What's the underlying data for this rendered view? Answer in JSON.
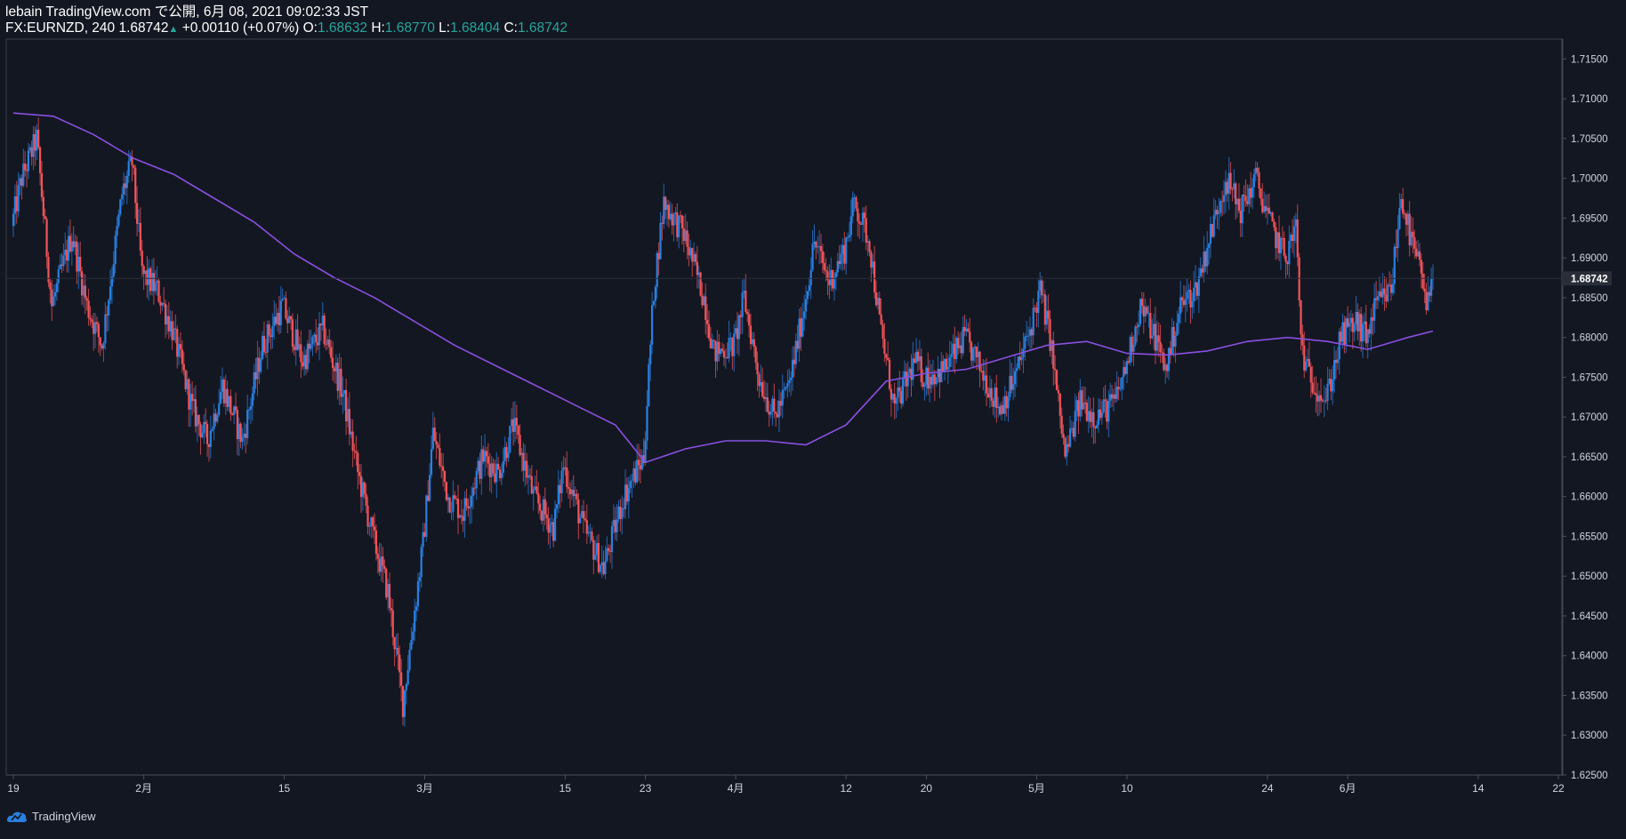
{
  "header": {
    "publish_line": "lebain TradingView.com で公開, 6月 08, 2021 09:02:33 JST",
    "symbol": "FX:EURNZD, 240",
    "last": "1.68742",
    "change": "+0.00110 (+0.07%)",
    "o_label": "O:",
    "o_value": "1.68632",
    "h_label": "H:",
    "h_value": "1.68770",
    "l_label": "L:",
    "l_value": "1.68404",
    "c_label": "C:",
    "c_value": "1.68742"
  },
  "footer": {
    "brand": "TradingView"
  },
  "colors": {
    "background": "#131722",
    "up": "#2a80e0",
    "down": "#f0545a",
    "ma": "#8a50e0",
    "axis_text": "#d1d4dc",
    "accent_green": "#26a69a"
  },
  "chart_data": {
    "type": "candlestick",
    "symbol": "FX:EURNZD",
    "interval": "240",
    "ylim": [
      1.625,
      1.7175
    ],
    "y_ticks": [
      "1.71500",
      "1.71000",
      "1.70500",
      "1.70000",
      "1.69500",
      "1.69000",
      "1.68500",
      "1.68000",
      "1.67500",
      "1.67000",
      "1.66500",
      "1.66000",
      "1.65500",
      "1.65000",
      "1.64500",
      "1.64000",
      "1.63500",
      "1.63000",
      "1.62500"
    ],
    "last_price_label": "1.68742",
    "last_price": 1.68742,
    "x_ticks": [
      {
        "label": "19",
        "day": 0
      },
      {
        "label": "2月",
        "day": 13
      },
      {
        "label": "15",
        "day": 27
      },
      {
        "label": "3月",
        "day": 41
      },
      {
        "label": "15",
        "day": 55
      },
      {
        "label": "23",
        "day": 63
      },
      {
        "label": "4月",
        "day": 72
      },
      {
        "label": "12",
        "day": 83
      },
      {
        "label": "20",
        "day": 91
      },
      {
        "label": "5月",
        "day": 102
      },
      {
        "label": "10",
        "day": 111
      },
      {
        "label": "24",
        "day": 125
      },
      {
        "label": "6月",
        "day": 133
      },
      {
        "label": "14",
        "day": 146
      },
      {
        "label": "22",
        "day": 154
      }
    ],
    "price_path": [
      {
        "day": 0,
        "price": 1.694
      },
      {
        "day": 1,
        "price": 1.7
      },
      {
        "day": 2.5,
        "price": 1.705
      },
      {
        "day": 4,
        "price": 1.684
      },
      {
        "day": 6,
        "price": 1.693
      },
      {
        "day": 7.5,
        "price": 1.684
      },
      {
        "day": 9,
        "price": 1.679
      },
      {
        "day": 11,
        "price": 1.698
      },
      {
        "day": 12,
        "price": 1.702
      },
      {
        "day": 13,
        "price": 1.688
      },
      {
        "day": 14.5,
        "price": 1.686
      },
      {
        "day": 16,
        "price": 1.681
      },
      {
        "day": 18,
        "price": 1.671
      },
      {
        "day": 19.5,
        "price": 1.667
      },
      {
        "day": 21,
        "price": 1.674
      },
      {
        "day": 23,
        "price": 1.667
      },
      {
        "day": 25,
        "price": 1.679
      },
      {
        "day": 27,
        "price": 1.684
      },
      {
        "day": 29,
        "price": 1.677
      },
      {
        "day": 31,
        "price": 1.681
      },
      {
        "day": 33,
        "price": 1.673
      },
      {
        "day": 34.5,
        "price": 1.663
      },
      {
        "day": 36,
        "price": 1.655
      },
      {
        "day": 37.5,
        "price": 1.648
      },
      {
        "day": 39,
        "price": 1.634
      },
      {
        "day": 40,
        "price": 1.644
      },
      {
        "day": 41,
        "price": 1.654
      },
      {
        "day": 42,
        "price": 1.668
      },
      {
        "day": 43.5,
        "price": 1.66
      },
      {
        "day": 45,
        "price": 1.658
      },
      {
        "day": 47,
        "price": 1.665
      },
      {
        "day": 48.5,
        "price": 1.663
      },
      {
        "day": 50,
        "price": 1.669
      },
      {
        "day": 52,
        "price": 1.66
      },
      {
        "day": 54,
        "price": 1.656
      },
      {
        "day": 55,
        "price": 1.664
      },
      {
        "day": 57,
        "price": 1.656
      },
      {
        "day": 59,
        "price": 1.651
      },
      {
        "day": 61,
        "price": 1.66
      },
      {
        "day": 63,
        "price": 1.665
      },
      {
        "day": 64,
        "price": 1.686
      },
      {
        "day": 65,
        "price": 1.697
      },
      {
        "day": 67,
        "price": 1.693
      },
      {
        "day": 69,
        "price": 1.685
      },
      {
        "day": 70,
        "price": 1.678
      },
      {
        "day": 72,
        "price": 1.679
      },
      {
        "day": 73,
        "price": 1.685
      },
      {
        "day": 74.5,
        "price": 1.675
      },
      {
        "day": 76,
        "price": 1.67
      },
      {
        "day": 77.5,
        "price": 1.674
      },
      {
        "day": 79,
        "price": 1.684
      },
      {
        "day": 80,
        "price": 1.692
      },
      {
        "day": 81.5,
        "price": 1.687
      },
      {
        "day": 83,
        "price": 1.691
      },
      {
        "day": 84,
        "price": 1.697
      },
      {
        "day": 85.5,
        "price": 1.692
      },
      {
        "day": 86.5,
        "price": 1.682
      },
      {
        "day": 88,
        "price": 1.671
      },
      {
        "day": 90,
        "price": 1.677
      },
      {
        "day": 91,
        "price": 1.675
      },
      {
        "day": 93,
        "price": 1.676
      },
      {
        "day": 95,
        "price": 1.68
      },
      {
        "day": 97,
        "price": 1.675
      },
      {
        "day": 98.5,
        "price": 1.671
      },
      {
        "day": 100,
        "price": 1.675
      },
      {
        "day": 101.5,
        "price": 1.681
      },
      {
        "day": 102.5,
        "price": 1.686
      },
      {
        "day": 103.5,
        "price": 1.68
      },
      {
        "day": 105,
        "price": 1.665
      },
      {
        "day": 106.5,
        "price": 1.672
      },
      {
        "day": 108,
        "price": 1.67
      },
      {
        "day": 110,
        "price": 1.672
      },
      {
        "day": 111,
        "price": 1.676
      },
      {
        "day": 112.5,
        "price": 1.684
      },
      {
        "day": 114,
        "price": 1.68
      },
      {
        "day": 115,
        "price": 1.676
      },
      {
        "day": 116.5,
        "price": 1.684
      },
      {
        "day": 118,
        "price": 1.686
      },
      {
        "day": 119.5,
        "price": 1.693
      },
      {
        "day": 121,
        "price": 1.7
      },
      {
        "day": 122.5,
        "price": 1.696
      },
      {
        "day": 124,
        "price": 1.7
      },
      {
        "day": 125.5,
        "price": 1.694
      },
      {
        "day": 127,
        "price": 1.69
      },
      {
        "day": 128,
        "price": 1.694
      },
      {
        "day": 128.5,
        "price": 1.68
      },
      {
        "day": 129,
        "price": 1.676
      },
      {
        "day": 131,
        "price": 1.672
      },
      {
        "day": 132.5,
        "price": 1.68
      },
      {
        "day": 134,
        "price": 1.682
      },
      {
        "day": 135,
        "price": 1.68
      },
      {
        "day": 136,
        "price": 1.684
      },
      {
        "day": 137.5,
        "price": 1.686
      },
      {
        "day": 138.5,
        "price": 1.698
      },
      {
        "day": 139.5,
        "price": 1.692
      },
      {
        "day": 140.5,
        "price": 1.688
      },
      {
        "day": 141,
        "price": 1.683
      },
      {
        "day": 141.5,
        "price": 1.687
      }
    ],
    "ma_path": [
      {
        "day": 0,
        "price": 1.7082
      },
      {
        "day": 4,
        "price": 1.7078
      },
      {
        "day": 8,
        "price": 1.7055
      },
      {
        "day": 12,
        "price": 1.7025
      },
      {
        "day": 16,
        "price": 1.7005
      },
      {
        "day": 20,
        "price": 1.6975
      },
      {
        "day": 24,
        "price": 1.6945
      },
      {
        "day": 28,
        "price": 1.6905
      },
      {
        "day": 32,
        "price": 1.6875
      },
      {
        "day": 36,
        "price": 1.685
      },
      {
        "day": 40,
        "price": 1.682
      },
      {
        "day": 44,
        "price": 1.679
      },
      {
        "day": 48,
        "price": 1.6765
      },
      {
        "day": 52,
        "price": 1.674
      },
      {
        "day": 56,
        "price": 1.6715
      },
      {
        "day": 60,
        "price": 1.669
      },
      {
        "day": 63,
        "price": 1.6643
      },
      {
        "day": 67,
        "price": 1.666
      },
      {
        "day": 71,
        "price": 1.667
      },
      {
        "day": 75,
        "price": 1.667
      },
      {
        "day": 79,
        "price": 1.6665
      },
      {
        "day": 83,
        "price": 1.669
      },
      {
        "day": 87,
        "price": 1.6745
      },
      {
        "day": 91,
        "price": 1.6755
      },
      {
        "day": 95,
        "price": 1.676
      },
      {
        "day": 99,
        "price": 1.6775
      },
      {
        "day": 103,
        "price": 1.679
      },
      {
        "day": 107,
        "price": 1.6795
      },
      {
        "day": 111,
        "price": 1.678
      },
      {
        "day": 115,
        "price": 1.6778
      },
      {
        "day": 119,
        "price": 1.6783
      },
      {
        "day": 123,
        "price": 1.6795
      },
      {
        "day": 127,
        "price": 1.68
      },
      {
        "day": 131,
        "price": 1.6795
      },
      {
        "day": 135,
        "price": 1.6785
      },
      {
        "day": 139,
        "price": 1.68
      },
      {
        "day": 141.5,
        "price": 1.6808
      }
    ]
  }
}
